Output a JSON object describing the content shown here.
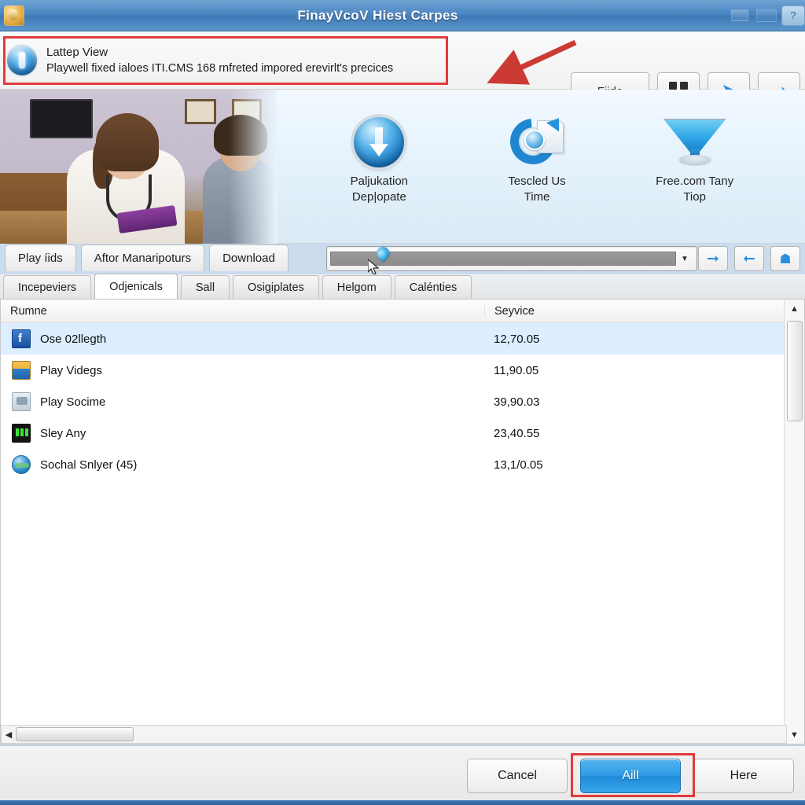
{
  "window": {
    "title": "FinayVcoV Hiest Carpes",
    "app_icon": "app-icon",
    "minimize_label": "",
    "restore_label": "",
    "help_label": "?"
  },
  "banner": {
    "icon": "info-download-icon",
    "title": "Lattep View",
    "subtitle": "Playwell fixed ialoes ITI.CMS 168 rnfreted impored erevirlt's precices",
    "highlight_color": "#e23b3b",
    "arrow_color": "#cc3b33"
  },
  "toolbar": {
    "hide_label": "Fiide",
    "grid_icon": "grid-icon",
    "back_icon": "arrow-left-icon",
    "forward_icon": "arrow-right-icon"
  },
  "strip": {
    "photo_alt": "girl-reading-photo",
    "features": [
      {
        "icon": "download-circle-icon",
        "label": "Paljukation\nDep|opate"
      },
      {
        "icon": "sync-refresh-icon",
        "label": "Tescled Us\nTime"
      },
      {
        "icon": "funnel-filter-icon",
        "label": "Free.com Tany\nTiop"
      }
    ]
  },
  "tabs_top": [
    {
      "label": "Play íids"
    },
    {
      "label": "Aftor Manaripoturs"
    },
    {
      "label": "Download"
    }
  ],
  "combo": {
    "value": "",
    "placeholder": "",
    "caret_icon": "chevron-down-icon",
    "pin_icon": "map-pin-icon"
  },
  "combo_buttons": [
    {
      "icon": "arrow-right-icon"
    },
    {
      "icon": "reply-arrow-icon"
    },
    {
      "icon": "home-shield-icon"
    }
  ],
  "tabs_main": [
    {
      "label": "Incepeviers",
      "active": false
    },
    {
      "label": "Odjenicals",
      "active": true
    },
    {
      "label": "Sall",
      "active": false
    },
    {
      "label": "Osigiplates",
      "active": false
    },
    {
      "label": "Helgom",
      "active": false
    },
    {
      "label": "Calénties",
      "active": false
    }
  ],
  "list": {
    "columns": [
      "Rumne",
      "Seyvice"
    ],
    "rows": [
      {
        "icon": "blue-square-icon",
        "name": "Ose 02llegth",
        "service": "12,70.05",
        "selected": true
      },
      {
        "icon": "media-player-icon",
        "name": "Play Videgs",
        "service": "11,90.05",
        "selected": false
      },
      {
        "icon": "disk-drive-icon",
        "name": "Play Socime",
        "service": "39,90.03",
        "selected": false
      },
      {
        "icon": "equalizer-icon",
        "name": "Sley Any",
        "service": "23,40.55",
        "selected": false
      },
      {
        "icon": "globe-icon",
        "name": "Sochal Snlyer (45)",
        "service": "13,1/0.05",
        "selected": false
      }
    ]
  },
  "scrollbars": {
    "v_up_icon": "triangle-up-icon",
    "v_down_icon": "triangle-down-icon",
    "h_left_icon": "triangle-left-icon"
  },
  "footer": {
    "cancel_label": "Cancel",
    "primary_label": "Aill",
    "here_label": "Here",
    "primary_color": "#2e9ae4",
    "highlight_color": "#e23b3b"
  }
}
